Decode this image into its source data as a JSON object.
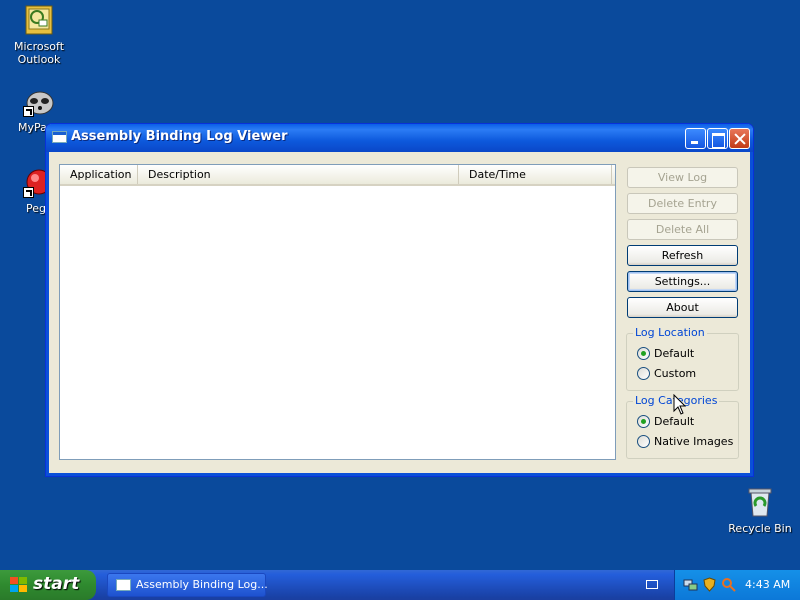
{
  "desktop": {
    "icons": [
      {
        "label": "Microsoft\nOutlook",
        "name": "outlook-icon"
      },
      {
        "label": "MyPa",
        "name": "mypal-icon"
      },
      {
        "label": "Peg",
        "name": "peg-icon"
      },
      {
        "label": "Recycle Bin",
        "name": "recycle-bin-icon"
      }
    ]
  },
  "window": {
    "title": "Assembly Binding Log Viewer",
    "columns": [
      "Application",
      "Description",
      "Date/Time"
    ],
    "buttons": {
      "view_log": "View Log",
      "delete_entry": "Delete Entry",
      "delete_all": "Delete All",
      "refresh": "Refresh",
      "settings": "Settings...",
      "about": "About"
    },
    "log_location": {
      "legend": "Log Location",
      "options": [
        "Default",
        "Custom"
      ],
      "selected": "Default"
    },
    "log_categories": {
      "legend": "Log Categories",
      "options": [
        "Default",
        "Native Images"
      ],
      "selected": "Default"
    }
  },
  "taskbar": {
    "start_label": "start",
    "task_label": "Assembly Binding Log...",
    "clock": "4:43 AM"
  },
  "colors": {
    "desktop": "#0a4a9c",
    "title_bar": "#0a5ee8",
    "window_bg": "#ece9d8",
    "group_legend": "#0046d5"
  }
}
